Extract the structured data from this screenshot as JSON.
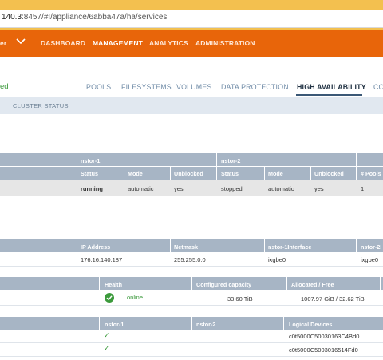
{
  "browser": {
    "url_host": "140.3",
    "url_rest": ":8457/#!/appliance/6abba47a/ha/services"
  },
  "topnav": {
    "left_fragment": "er",
    "items": [
      {
        "label": "DASHBOARD",
        "active": false
      },
      {
        "label": "MANAGEMENT",
        "active": true
      },
      {
        "label": "ANALYTICS",
        "active": false
      },
      {
        "label": "ADMINISTRATION",
        "active": false
      }
    ]
  },
  "page": {
    "status_fragment": "ed",
    "tabs": [
      {
        "label": "POOLS",
        "active": false
      },
      {
        "label": "FILESYSTEMS",
        "active": false
      },
      {
        "label": "VOLUMES",
        "active": false
      },
      {
        "label": "DATA PROTECTION",
        "active": false
      },
      {
        "label": "HIGH AVAILABILITY",
        "active": true
      },
      {
        "label": "CO",
        "active": false
      }
    ],
    "subbar_label": "CLUSTER STATUS"
  },
  "cluster_table": {
    "group_headers": [
      "nstor-1",
      "nstor-2"
    ],
    "columns": [
      "Status",
      "Mode",
      "Unblocked",
      "Status",
      "Mode",
      "Unblocked",
      "# Pools"
    ],
    "row": [
      "running",
      "automatic",
      "yes",
      "stopped",
      "automatic",
      "yes",
      "1"
    ]
  },
  "network_table": {
    "columns": [
      "IP Address",
      "Netmask",
      "nstor-1Interface",
      "nstor-2I"
    ],
    "row": [
      "176.16.140.187",
      "255.255.0.0",
      "ixgbe0",
      "ixgbe0"
    ]
  },
  "pool_table": {
    "columns": [
      "Health",
      "Configured capacity",
      "Allocated / Free"
    ],
    "row": {
      "health": "online",
      "capacity": "33.60 TiB",
      "allocated": "1007.97 GiB / 32.62 TiB"
    }
  },
  "devices_table": {
    "columns": [
      "nstor-1",
      "nstor-2",
      "Logical Devices"
    ],
    "rows": [
      {
        "check": "✓",
        "device": "c0t5000C50030163C4Bd0"
      },
      {
        "check": "✓",
        "device": "c0t5000C5003016514Fd0"
      }
    ]
  },
  "colors": {
    "accent_orange": "#e8650a",
    "table_header": "#a7b5c5",
    "ok_green": "#3c9a3c"
  }
}
